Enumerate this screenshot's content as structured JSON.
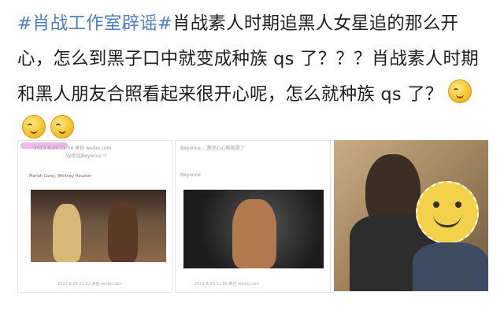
{
  "post": {
    "hashtag": "#肖战工作室辟谣#",
    "text": "肖战素人时期追黑人女星追的那么开心，怎么到黑子口中就变成种族 qs 了？？？肖战素人时期和黑人朋友合照看起来很开心呢，怎么就种族 qs 了？",
    "emojis": [
      "grin-emoji",
      "grin-emoji",
      "grin-emoji"
    ]
  },
  "screenshot1": {
    "header": "2013-8-26 11:54 来自 weibo.com",
    "subheader": "/@你比Beyonce !!",
    "body": "Mariah Carey, Whitney Houston",
    "footer": "2013-8-26 11:52 来自 weibo.com"
  },
  "screenshot2": {
    "header": "Beyonce… 那也心心啦就是了",
    "subheader": "Beyonce",
    "footer": "2013-8-26 11:50 来自 weibo.com"
  },
  "colors": {
    "hashtag": "#4f7fc3",
    "text": "#1f1f1f",
    "mask": "#e8a8e0"
  }
}
